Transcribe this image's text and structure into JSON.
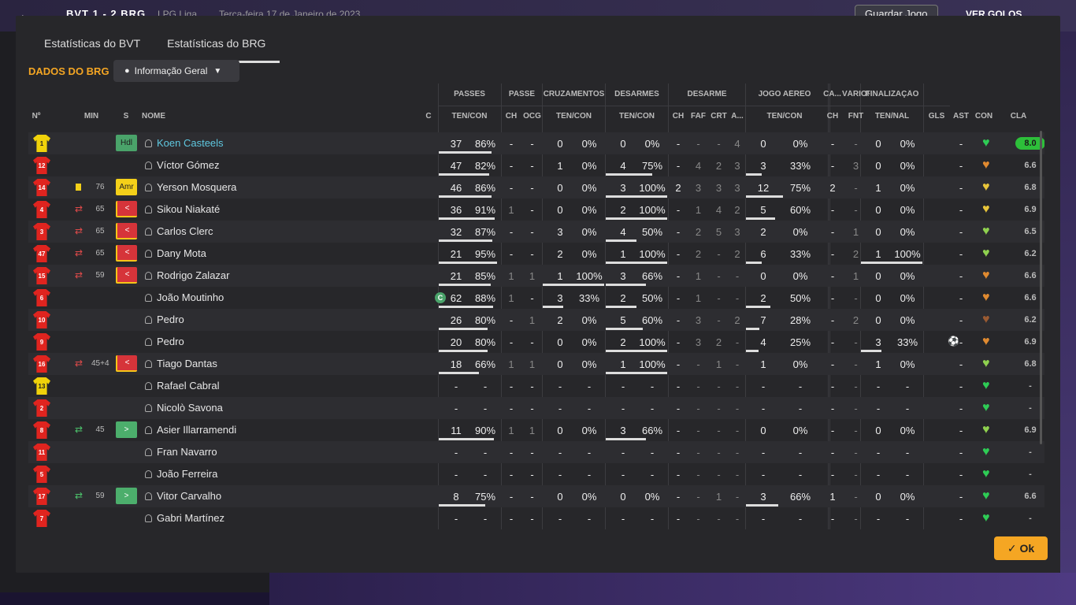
{
  "topbar": {
    "score": "BVT 1 - 2 BRG",
    "league": "LPG Liga",
    "date": "Terça-feira 17 de Janeiro de 2023",
    "save_label": "Guardar Jogo",
    "goals_label": "VER GOLOS"
  },
  "tabs": [
    {
      "label": "Estatísticas do BVT"
    },
    {
      "label": "Estatísticas do BRG"
    }
  ],
  "team_label": "DADOS DO BRG",
  "dropdown": {
    "value": "Informação Geral"
  },
  "groups": {
    "passes": "PASSES",
    "passe": "PASSE",
    "cruzamentos": "CRUZAMENTOS",
    "desarmes": "DESARMES",
    "desarme": "DESARME",
    "jogo_aereo": "JOGO AÉREO",
    "ca": "CA...",
    "varios": "VÁRIOS",
    "finalizacao": "FINALIZAÇÃO"
  },
  "headers": {
    "no": "Nº",
    "min": "MIN",
    "s": "S",
    "nome": "NOME",
    "c": "C",
    "pas_tc": "TEN/CON",
    "pas_ch": "CH",
    "pas_ocg": "OCG",
    "cru_tc": "TEN/CON",
    "des_tc": "TEN/CON",
    "d_ch": "CH",
    "d_faf": "FAF",
    "d_crt": "CRT",
    "d_a": "A...",
    "aer_tc": "TEN/CON",
    "ca_ch": "CH",
    "fnt": "FNT",
    "fin_tn": "TEN/NAL",
    "gls": "GLS",
    "ast": "AST",
    "con": "CON",
    "cla": "CLA"
  },
  "players": [
    {
      "no": "1",
      "shirt": "yel",
      "min": "",
      "sub": "",
      "card": false,
      "s": "Hdl",
      "stype": "hdl",
      "name": "Koen Casteels",
      "highlight": true,
      "captain": false,
      "pa": "37",
      "pp": "86%",
      "pch": "-",
      "pog": "-",
      "ca": "0",
      "cp": "0%",
      "da": "0",
      "dp": "0%",
      "dch": "-",
      "faf": "-",
      "crt": "-",
      "dA": "4",
      "aa": "0",
      "ap": "0%",
      "cach": "-",
      "fnt": "-",
      "fa": "0",
      "fp": "0%",
      "gls": "",
      "ast": "-",
      "con": "green",
      "cla": "8.0",
      "best": true,
      "ball": false
    },
    {
      "no": "12",
      "shirt": "red",
      "min": "",
      "sub": "",
      "card": false,
      "s": "",
      "stype": "",
      "name": "Víctor Gómez",
      "highlight": false,
      "captain": false,
      "pa": "47",
      "pp": "82%",
      "pch": "-",
      "pog": "-",
      "ca": "1",
      "cp": "0%",
      "da": "4",
      "dp": "75%",
      "dch": "-",
      "faf": "4",
      "crt": "2",
      "dA": "3",
      "aa": "3",
      "ap": "33%",
      "cach": "-",
      "fnt": "3",
      "fa": "0",
      "fp": "0%",
      "gls": "",
      "ast": "-",
      "con": "orange",
      "cla": "6.6",
      "best": false,
      "ball": false
    },
    {
      "no": "14",
      "shirt": "red",
      "min": "76",
      "sub": "",
      "card": true,
      "s": "Amr",
      "stype": "amr",
      "name": "Yerson Mosquera",
      "highlight": false,
      "captain": false,
      "pa": "46",
      "pp": "86%",
      "pch": "-",
      "pog": "-",
      "ca": "0",
      "cp": "0%",
      "da": "3",
      "dp": "100%",
      "dch": "2",
      "faf": "3",
      "crt": "3",
      "dA": "3",
      "aa": "12",
      "ap": "75%",
      "cach": "2",
      "fnt": "-",
      "fa": "1",
      "fp": "0%",
      "gls": "",
      "ast": "-",
      "con": "yellow",
      "cla": "6.8",
      "best": false,
      "ball": false
    },
    {
      "no": "4",
      "shirt": "red",
      "min": "65",
      "sub": "out",
      "card": false,
      "s": "<",
      "stype": "out",
      "name": "Sikou Niakaté",
      "highlight": false,
      "captain": false,
      "pa": "36",
      "pp": "91%",
      "pch": "1",
      "pog": "-",
      "ca": "0",
      "cp": "0%",
      "da": "2",
      "dp": "100%",
      "dch": "-",
      "faf": "1",
      "crt": "4",
      "dA": "2",
      "aa": "5",
      "ap": "60%",
      "cach": "-",
      "fnt": "-",
      "fa": "0",
      "fp": "0%",
      "gls": "",
      "ast": "-",
      "con": "yellow",
      "cla": "6.9",
      "best": false,
      "ball": false
    },
    {
      "no": "3",
      "shirt": "red",
      "min": "65",
      "sub": "out",
      "card": false,
      "s": "<",
      "stype": "out",
      "name": "Carlos Clerc",
      "highlight": false,
      "captain": false,
      "pa": "32",
      "pp": "87%",
      "pch": "-",
      "pog": "-",
      "ca": "3",
      "cp": "0%",
      "da": "4",
      "dp": "50%",
      "dch": "-",
      "faf": "2",
      "crt": "5",
      "dA": "3",
      "aa": "2",
      "ap": "0%",
      "cach": "-",
      "fnt": "1",
      "fa": "0",
      "fp": "0%",
      "gls": "",
      "ast": "-",
      "con": "lime",
      "cla": "6.5",
      "best": false,
      "ball": false
    },
    {
      "no": "47",
      "shirt": "red",
      "min": "65",
      "sub": "out",
      "card": false,
      "s": "<",
      "stype": "out",
      "name": "Dany Mota",
      "highlight": false,
      "captain": false,
      "pa": "21",
      "pp": "95%",
      "pch": "-",
      "pog": "-",
      "ca": "2",
      "cp": "0%",
      "da": "1",
      "dp": "100%",
      "dch": "-",
      "faf": "2",
      "crt": "-",
      "dA": "2",
      "aa": "6",
      "ap": "33%",
      "cach": "-",
      "fnt": "2",
      "fa": "1",
      "fp": "100%",
      "gls": "",
      "ast": "-",
      "con": "lime",
      "cla": "6.2",
      "best": false,
      "ball": false
    },
    {
      "no": "15",
      "shirt": "red",
      "min": "59",
      "sub": "out",
      "card": false,
      "s": "<",
      "stype": "out",
      "name": "Rodrigo Zalazar",
      "highlight": false,
      "captain": false,
      "pa": "21",
      "pp": "85%",
      "pch": "1",
      "pog": "1",
      "ca": "1",
      "cp": "100%",
      "da": "3",
      "dp": "66%",
      "dch": "-",
      "faf": "1",
      "crt": "-",
      "dA": "-",
      "aa": "0",
      "ap": "0%",
      "cach": "-",
      "fnt": "1",
      "fa": "0",
      "fp": "0%",
      "gls": "",
      "ast": "-",
      "con": "orange",
      "cla": "6.6",
      "best": false,
      "ball": false
    },
    {
      "no": "6",
      "shirt": "red",
      "min": "",
      "sub": "",
      "card": false,
      "s": "",
      "stype": "",
      "name": "João Moutinho",
      "highlight": false,
      "captain": true,
      "pa": "62",
      "pp": "88%",
      "pch": "1",
      "pog": "-",
      "ca": "3",
      "cp": "33%",
      "da": "2",
      "dp": "50%",
      "dch": "-",
      "faf": "1",
      "crt": "-",
      "dA": "-",
      "aa": "2",
      "ap": "50%",
      "cach": "-",
      "fnt": "-",
      "fa": "0",
      "fp": "0%",
      "gls": "",
      "ast": "-",
      "con": "orange",
      "cla": "6.6",
      "best": false,
      "ball": false
    },
    {
      "no": "10",
      "shirt": "red",
      "min": "",
      "sub": "",
      "card": false,
      "s": "",
      "stype": "",
      "name": "Pedro",
      "highlight": false,
      "captain": false,
      "pa": "26",
      "pp": "80%",
      "pch": "-",
      "pog": "1",
      "ca": "2",
      "cp": "0%",
      "da": "5",
      "dp": "60%",
      "dch": "-",
      "faf": "3",
      "crt": "-",
      "dA": "2",
      "aa": "7",
      "ap": "28%",
      "cach": "-",
      "fnt": "2",
      "fa": "0",
      "fp": "0%",
      "gls": "",
      "ast": "-",
      "con": "brown",
      "cla": "6.2",
      "best": false,
      "ball": false
    },
    {
      "no": "9",
      "shirt": "red",
      "min": "",
      "sub": "",
      "card": false,
      "s": "",
      "stype": "",
      "name": "Pedro",
      "highlight": false,
      "captain": false,
      "pa": "20",
      "pp": "80%",
      "pch": "-",
      "pog": "-",
      "ca": "0",
      "cp": "0%",
      "da": "2",
      "dp": "100%",
      "dch": "-",
      "faf": "3",
      "crt": "2",
      "dA": "-",
      "aa": "4",
      "ap": "25%",
      "cach": "-",
      "fnt": "-",
      "fa": "3",
      "fp": "33%",
      "gls": "",
      "ast": "-",
      "con": "orange",
      "cla": "6.9",
      "best": false,
      "ball": true
    },
    {
      "no": "16",
      "shirt": "red",
      "min": "45+4",
      "sub": "out",
      "card": false,
      "s": "<",
      "stype": "out",
      "name": "Tiago Dantas",
      "highlight": false,
      "captain": false,
      "pa": "18",
      "pp": "66%",
      "pch": "1",
      "pog": "1",
      "ca": "0",
      "cp": "0%",
      "da": "1",
      "dp": "100%",
      "dch": "-",
      "faf": "-",
      "crt": "1",
      "dA": "-",
      "aa": "1",
      "ap": "0%",
      "cach": "-",
      "fnt": "-",
      "fa": "1",
      "fp": "0%",
      "gls": "",
      "ast": "-",
      "con": "lime",
      "cla": "6.8",
      "best": false,
      "ball": false
    },
    {
      "no": "13",
      "shirt": "yel",
      "min": "",
      "sub": "",
      "card": false,
      "s": "",
      "stype": "",
      "name": "Rafael Cabral",
      "highlight": false,
      "captain": false,
      "pa": "-",
      "pp": "-",
      "pch": "-",
      "pog": "-",
      "ca": "-",
      "cp": "-",
      "da": "-",
      "dp": "-",
      "dch": "-",
      "faf": "-",
      "crt": "-",
      "dA": "-",
      "aa": "-",
      "ap": "-",
      "cach": "-",
      "fnt": "-",
      "fa": "-",
      "fp": "-",
      "gls": "",
      "ast": "-",
      "con": "green",
      "cla": "-",
      "best": false,
      "ball": false
    },
    {
      "no": "2",
      "shirt": "red",
      "min": "",
      "sub": "",
      "card": false,
      "s": "",
      "stype": "",
      "name": "Nicolò Savona",
      "highlight": false,
      "captain": false,
      "pa": "-",
      "pp": "-",
      "pch": "-",
      "pog": "-",
      "ca": "-",
      "cp": "-",
      "da": "-",
      "dp": "-",
      "dch": "-",
      "faf": "-",
      "crt": "-",
      "dA": "-",
      "aa": "-",
      "ap": "-",
      "cach": "-",
      "fnt": "-",
      "fa": "-",
      "fp": "-",
      "gls": "",
      "ast": "-",
      "con": "green",
      "cla": "-",
      "best": false,
      "ball": false
    },
    {
      "no": "8",
      "shirt": "red",
      "min": "45",
      "sub": "in",
      "card": false,
      "s": ">",
      "stype": "in",
      "name": "Asier Illarramendi",
      "highlight": false,
      "captain": false,
      "pa": "11",
      "pp": "90%",
      "pch": "1",
      "pog": "1",
      "ca": "0",
      "cp": "0%",
      "da": "3",
      "dp": "66%",
      "dch": "-",
      "faf": "-",
      "crt": "-",
      "dA": "-",
      "aa": "0",
      "ap": "0%",
      "cach": "-",
      "fnt": "-",
      "fa": "0",
      "fp": "0%",
      "gls": "",
      "ast": "-",
      "con": "lime",
      "cla": "6.9",
      "best": false,
      "ball": false
    },
    {
      "no": "11",
      "shirt": "red",
      "min": "",
      "sub": "",
      "card": false,
      "s": "",
      "stype": "",
      "name": "Fran Navarro",
      "highlight": false,
      "captain": false,
      "pa": "-",
      "pp": "-",
      "pch": "-",
      "pog": "-",
      "ca": "-",
      "cp": "-",
      "da": "-",
      "dp": "-",
      "dch": "-",
      "faf": "-",
      "crt": "-",
      "dA": "-",
      "aa": "-",
      "ap": "-",
      "cach": "-",
      "fnt": "-",
      "fa": "-",
      "fp": "-",
      "gls": "",
      "ast": "-",
      "con": "green",
      "cla": "-",
      "best": false,
      "ball": false
    },
    {
      "no": "5",
      "shirt": "red",
      "min": "",
      "sub": "",
      "card": false,
      "s": "",
      "stype": "",
      "name": "João Ferreira",
      "highlight": false,
      "captain": false,
      "pa": "-",
      "pp": "-",
      "pch": "-",
      "pog": "-",
      "ca": "-",
      "cp": "-",
      "da": "-",
      "dp": "-",
      "dch": "-",
      "faf": "-",
      "crt": "-",
      "dA": "-",
      "aa": "-",
      "ap": "-",
      "cach": "-",
      "fnt": "-",
      "fa": "-",
      "fp": "-",
      "gls": "",
      "ast": "-",
      "con": "green",
      "cla": "-",
      "best": false,
      "ball": false
    },
    {
      "no": "17",
      "shirt": "red",
      "min": "59",
      "sub": "in",
      "card": false,
      "s": ">",
      "stype": "in",
      "name": "Vitor Carvalho",
      "highlight": false,
      "captain": false,
      "pa": "8",
      "pp": "75%",
      "pch": "-",
      "pog": "-",
      "ca": "0",
      "cp": "0%",
      "da": "0",
      "dp": "0%",
      "dch": "-",
      "faf": "-",
      "crt": "1",
      "dA": "-",
      "aa": "3",
      "ap": "66%",
      "cach": "1",
      "fnt": "-",
      "fa": "0",
      "fp": "0%",
      "gls": "",
      "ast": "-",
      "con": "green",
      "cla": "6.6",
      "best": false,
      "ball": false
    },
    {
      "no": "7",
      "shirt": "red",
      "min": "",
      "sub": "",
      "card": false,
      "s": "",
      "stype": "",
      "name": "Gabri Martínez",
      "highlight": false,
      "captain": false,
      "pa": "-",
      "pp": "-",
      "pch": "-",
      "pog": "-",
      "ca": "-",
      "cp": "-",
      "da": "-",
      "dp": "-",
      "dch": "-",
      "faf": "-",
      "crt": "-",
      "dA": "-",
      "aa": "-",
      "ap": "-",
      "cach": "-",
      "fnt": "-",
      "fa": "-",
      "fp": "-",
      "gls": "",
      "ast": "-",
      "con": "green",
      "cla": "-",
      "best": false,
      "ball": false
    }
  ],
  "ok_label": "Ok",
  "colors": {
    "accent": "#f5a623",
    "best_rating": "#2dbf3a",
    "heart_green": "#2ecc55",
    "heart_lime": "#8fd14f",
    "heart_yellow": "#e8c53a",
    "heart_orange": "#e08a30",
    "heart_brown": "#9a5a32",
    "name_highlight": "#5fc8e0"
  }
}
